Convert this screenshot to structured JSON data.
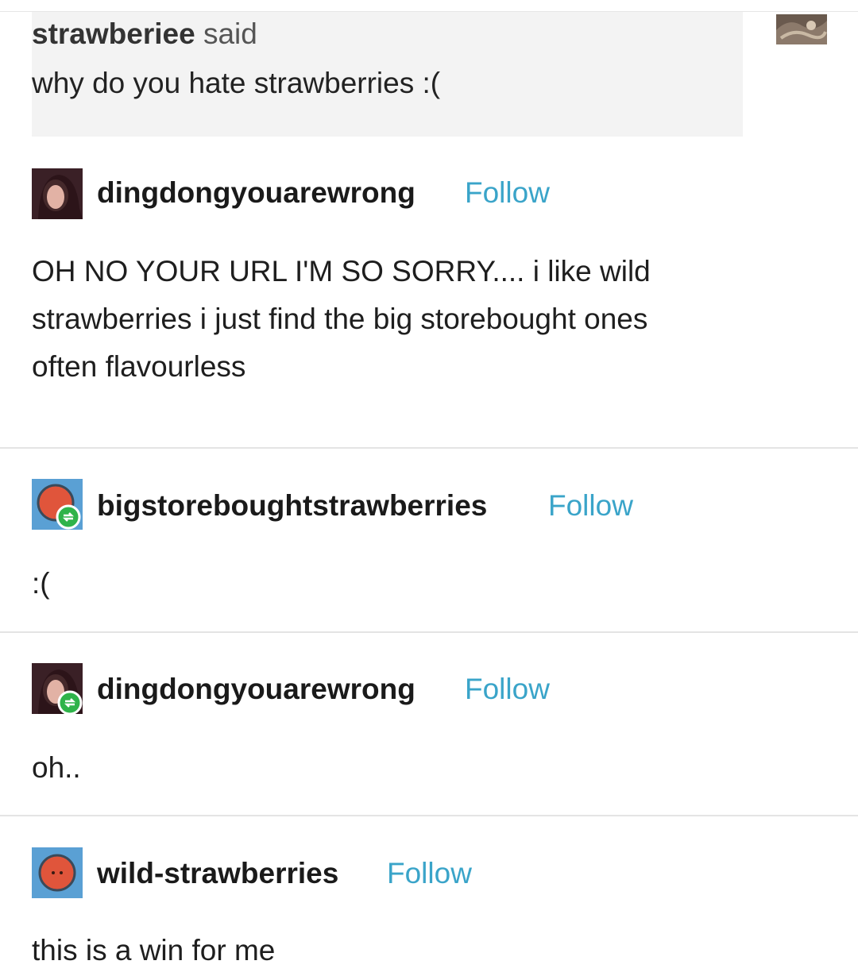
{
  "ask": {
    "asker": "strawberiee",
    "said_label": "said",
    "question": "why do you hate strawberries :("
  },
  "posts": [
    {
      "username": "dingdongyouarewrong",
      "follow_label": "Follow",
      "body": "OH NO YOUR URL I'M SO SORRY.... i like wild\nstrawberries i just find the big storebought ones\noften flavourless",
      "avatar_icon": "photo-avatar-icon",
      "reblog_badge": false
    },
    {
      "username": "bigstoreboughtstrawberries",
      "follow_label": "Follow",
      "body": ":(",
      "avatar_icon": "strawberry-avatar-icon",
      "reblog_badge": true
    },
    {
      "username": "dingdongyouarewrong",
      "follow_label": "Follow",
      "body": "oh..",
      "avatar_icon": "photo-avatar-icon",
      "reblog_badge": true
    },
    {
      "username": "wild-strawberries",
      "follow_label": "Follow",
      "body": "this is a win for me",
      "avatar_icon": "strawberry-avatar-icon",
      "reblog_badge": false
    }
  ],
  "colors": {
    "follow_link": "#3aa4c9",
    "reblog_badge": "#2fb34a",
    "ask_background": "#f3f3f3",
    "avatar_blue": "#5aa0d4"
  }
}
